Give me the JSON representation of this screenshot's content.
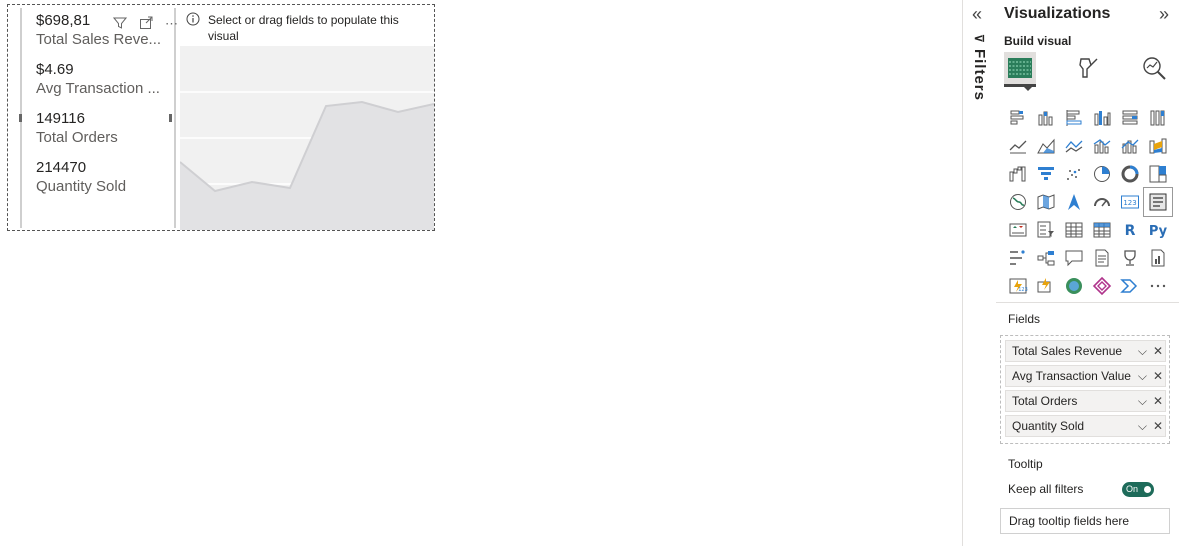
{
  "card": {
    "kpis": [
      {
        "value": "$698,81",
        "label": "Total Sales Reve..."
      },
      {
        "value": "$4.69",
        "label": "Avg Transaction ..."
      },
      {
        "value": "149116",
        "label": "Total Orders"
      },
      {
        "value": "214470",
        "label": "Quantity Sold"
      }
    ]
  },
  "placeholder": {
    "message": "Select or drag fields to populate this visual"
  },
  "filters": {
    "label": "Filters"
  },
  "visualizations": {
    "title": "Visualizations",
    "build_label": "Build visual",
    "fields_label": "Fields",
    "field_wells": [
      "Total Sales Revenue",
      "Avg Transaction Value",
      "Total Orders",
      "Quantity Sold"
    ],
    "tooltip_label": "Tooltip",
    "keep_filters_label": "Keep all filters",
    "toggle_label": "On",
    "drag_tooltip_placeholder": "Drag tooltip fields here",
    "visual_icons": [
      "stacked-bar-icon",
      "stacked-column-icon",
      "clustered-bar-icon",
      "clustered-column-icon",
      "100-stacked-bar-icon",
      "100-stacked-column-icon",
      "line-chart-icon",
      "area-chart-icon",
      "stacked-area-icon",
      "line-clustered-column-icon",
      "line-stacked-column-icon",
      "ribbon-chart-icon",
      "waterfall-icon",
      "funnel-icon",
      "scatter-icon",
      "pie-chart-icon",
      "donut-chart-icon",
      "treemap-icon",
      "map-icon",
      "filled-map-icon",
      "azure-map-icon",
      "gauge-icon",
      "card-icon",
      "multi-row-card-icon",
      "kpi-icon",
      "slicer-icon",
      "table-icon",
      "matrix-icon",
      "r-visual-icon",
      "python-visual-icon",
      "key-influencers-icon",
      "decomposition-tree-icon",
      "qa-icon",
      "narrative-icon",
      "metrics-icon",
      "paginated-report-icon",
      "power-apps-icon",
      "power-automate-icon",
      "arcgis-icon",
      "diamond-icon",
      "chevron-visual-icon",
      "more-visuals-icon"
    ]
  }
}
